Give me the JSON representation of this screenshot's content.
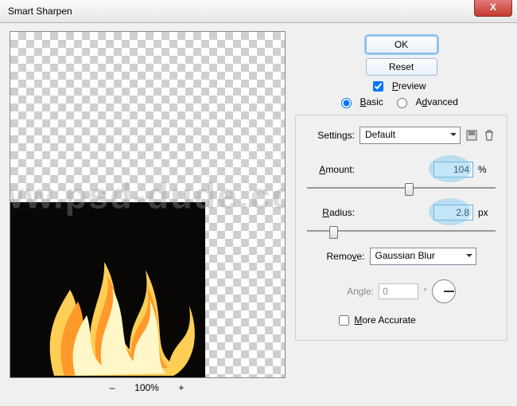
{
  "window": {
    "title": "Smart Sharpen"
  },
  "buttons": {
    "ok": "OK",
    "reset": "Reset",
    "close": "X"
  },
  "preview": {
    "label": "Preview",
    "checked": true
  },
  "mode": {
    "basic": "Basic",
    "advanced": "Advanced",
    "selected": "basic"
  },
  "settings": {
    "label": "Settings:",
    "value": "Default",
    "save_icon": "save-preset-icon",
    "delete_icon": "delete-preset-icon"
  },
  "amount": {
    "label": "Amount:",
    "value": "104",
    "unit": "%",
    "slider_percent": 52
  },
  "radius": {
    "label": "Radius:",
    "value": "2.8",
    "unit": "px",
    "slider_percent": 12
  },
  "remove": {
    "label": "Remove:",
    "value": "Gaussian Blur"
  },
  "angle": {
    "label": "Angle:",
    "value": "0",
    "unit": "°"
  },
  "accurate": {
    "label": "More Accurate",
    "checked": false
  },
  "zoom": {
    "minus": "–",
    "percent": "100%",
    "plus": "+"
  },
  "watermark": "www.psd-dude.com"
}
